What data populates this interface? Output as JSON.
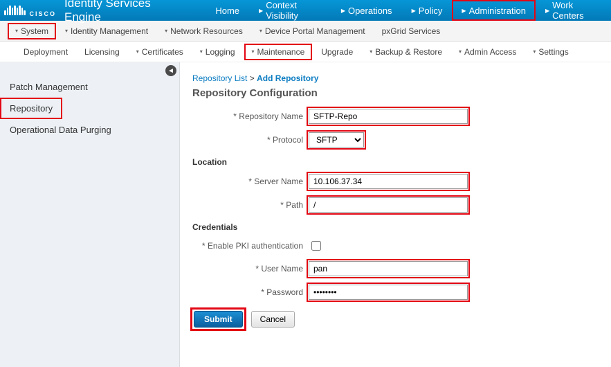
{
  "brand": {
    "cisco": "CISCO",
    "product": "Identity Services Engine"
  },
  "topnav": [
    {
      "label": "Home",
      "caret": false
    },
    {
      "label": "Context Visibility",
      "caret": true
    },
    {
      "label": "Operations",
      "caret": true
    },
    {
      "label": "Policy",
      "caret": true
    },
    {
      "label": "Administration",
      "caret": true,
      "hl": true
    },
    {
      "label": "Work Centers",
      "caret": true
    }
  ],
  "subnav": [
    {
      "label": "System",
      "caret": true,
      "hl": true
    },
    {
      "label": "Identity Management",
      "caret": true
    },
    {
      "label": "Network Resources",
      "caret": true
    },
    {
      "label": "Device Portal Management",
      "caret": true
    },
    {
      "label": "pxGrid Services",
      "caret": false
    }
  ],
  "subsubnav": [
    {
      "label": "Deployment",
      "caret": false
    },
    {
      "label": "Licensing",
      "caret": false
    },
    {
      "label": "Certificates",
      "caret": true
    },
    {
      "label": "Logging",
      "caret": true
    },
    {
      "label": "Maintenance",
      "caret": true,
      "hl": true
    },
    {
      "label": "Upgrade",
      "caret": false
    },
    {
      "label": "Backup & Restore",
      "caret": true
    },
    {
      "label": "Admin Access",
      "caret": true
    },
    {
      "label": "Settings",
      "caret": true
    }
  ],
  "sidebar": {
    "items": [
      {
        "label": "Patch Management"
      },
      {
        "label": "Repository",
        "hl": true
      },
      {
        "label": "Operational Data Purging"
      }
    ]
  },
  "breadcrumb": {
    "parent": "Repository List",
    "sep": ">",
    "current": "Add Repository"
  },
  "page_title": "Repository Configuration",
  "form": {
    "repo_name_label": "* Repository Name",
    "repo_name_value": "SFTP-Repo",
    "protocol_label": "* Protocol",
    "protocol_value": "SFTP",
    "location_head": "Location",
    "server_label": "* Server Name",
    "server_value": "10.106.37.34",
    "path_label": "* Path",
    "path_value": "/",
    "credentials_head": "Credentials",
    "pki_label": "* Enable PKI authentication",
    "pki_checked": false,
    "user_label": "* User Name",
    "user_value": "pan",
    "pass_label": "* Password",
    "pass_value": "••••••••"
  },
  "buttons": {
    "submit": "Submit",
    "cancel": "Cancel"
  }
}
